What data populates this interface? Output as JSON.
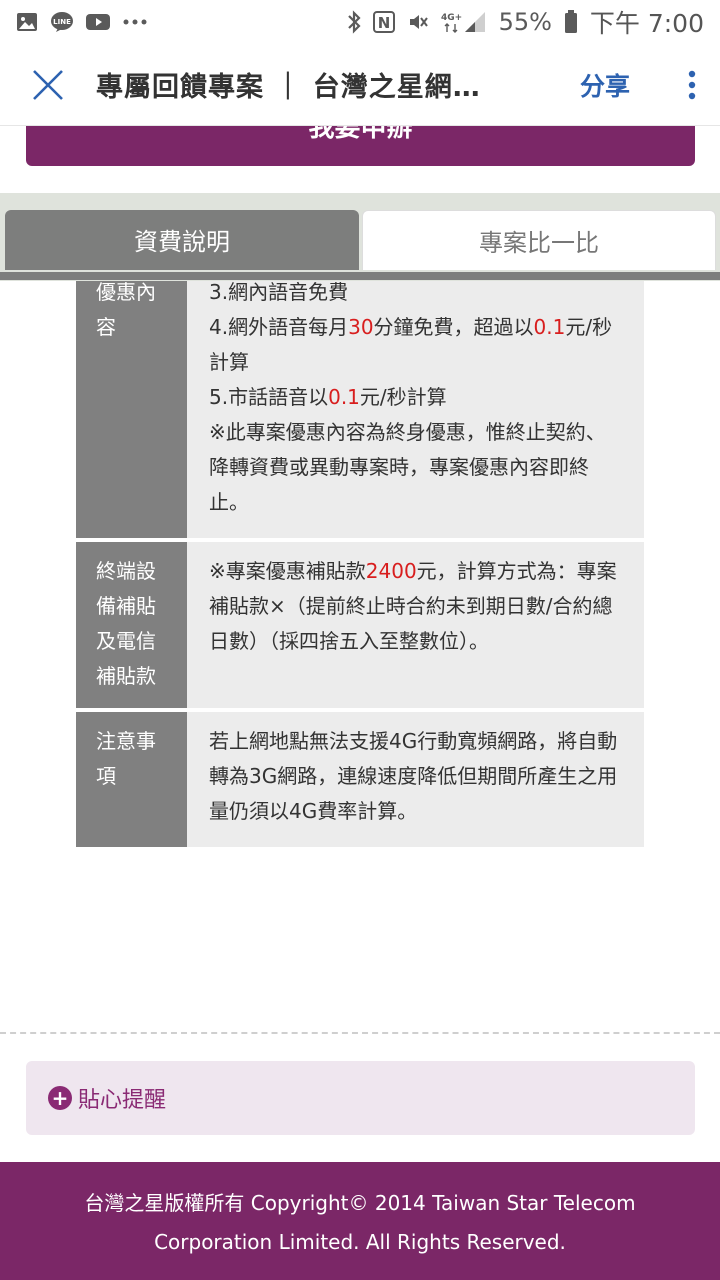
{
  "status_bar": {
    "battery": "55%",
    "time": "下午 7:00",
    "net_label": "4G+",
    "icons": [
      "gallery-icon",
      "line-icon",
      "youtube-icon",
      "more-dots-icon",
      "bluetooth-icon",
      "nfc-icon",
      "mute-icon",
      "signal-icon",
      "battery-icon"
    ]
  },
  "app_bar": {
    "title": "專屬回饋專案 ｜ 台灣之星網…",
    "share_label": "分享"
  },
  "apply_button": {
    "label": "我要申辦"
  },
  "tabs": [
    {
      "label": "資費說明",
      "active": true
    },
    {
      "label": "專案比一比",
      "active": false
    }
  ],
  "table": {
    "rows": [
      {
        "header": "優惠內容",
        "lines": [
          "3.網內語音免費",
          "4.網外語音每月30分鐘免費，超過以0.1元/秒計算",
          "5.市話語音以0.1元/秒計算",
          "※此專案優惠內容為終身優惠，惟終止契約、降轉資費或異動專案時，專案優惠內容即終止。"
        ]
      },
      {
        "header": "終端設備補貼及電信補貼款",
        "text": "※專案優惠補貼款2400元，計算方式為：專案補貼款×（提前終止時合約未到期日數/合約總日數）（採四捨五入至整數位）。"
      },
      {
        "header": "注意事項",
        "text": "若上網地點無法支援4G行動寬頻網路，將自動轉為3G網路，連線速度降低但期間所產生之用量仍須以4G費率計算。"
      }
    ],
    "highlight_color": "#d81e1e"
  },
  "reminder": {
    "label": "貼心提醒"
  },
  "footer": {
    "line1": "台灣之星版權所有 Copyright© 2014 Taiwan Star Telecom",
    "line2": "Corporation Limited. All Rights Reserved."
  },
  "colors": {
    "brand": "#7b2767",
    "tab_active": "#7d7e7d",
    "link": "#2d62b0"
  }
}
